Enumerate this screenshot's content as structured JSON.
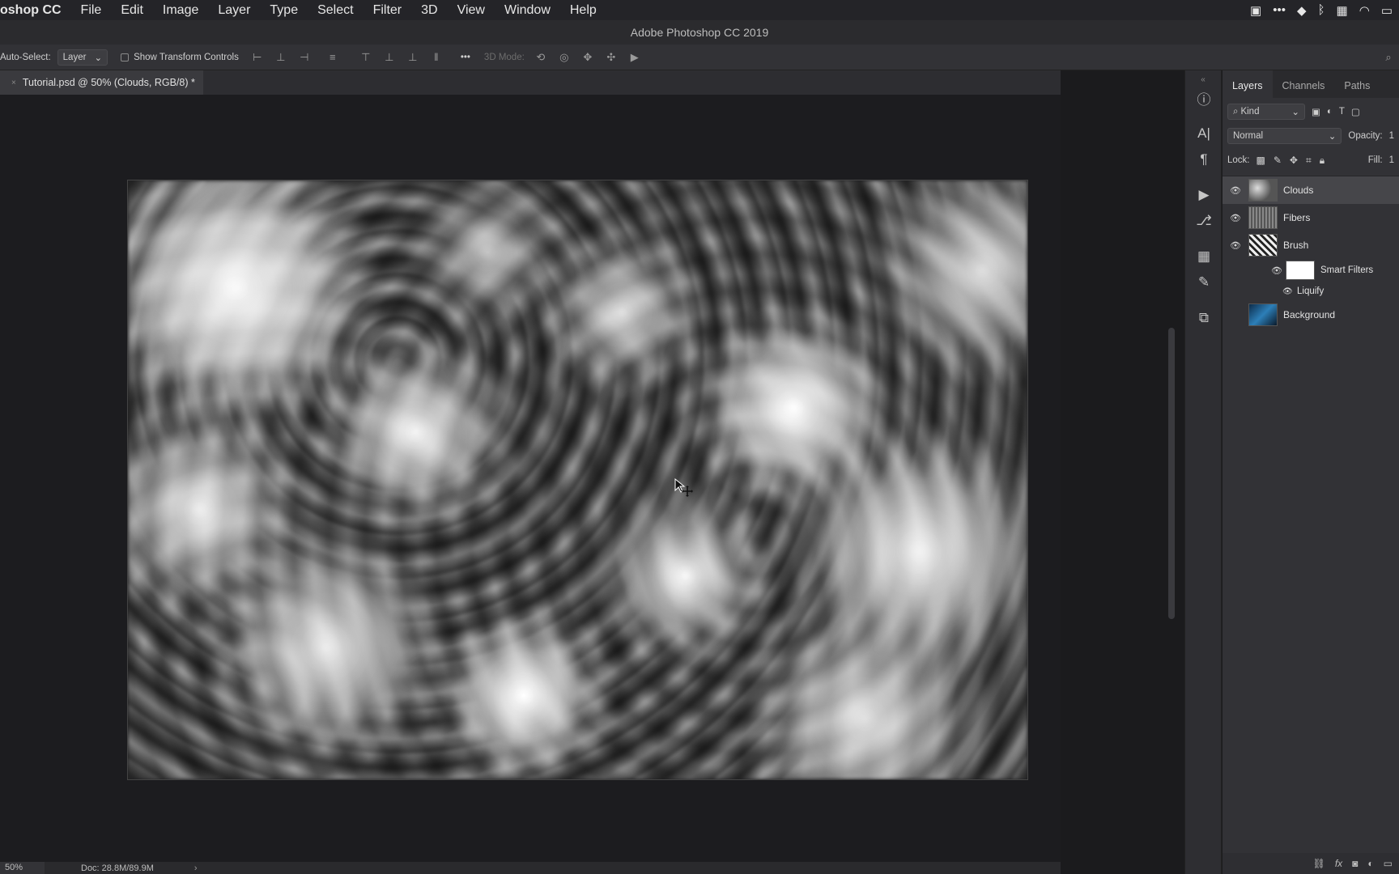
{
  "menubar": {
    "app_name": "oshop CC",
    "items": [
      "File",
      "Edit",
      "Image",
      "Layer",
      "Type",
      "Select",
      "Filter",
      "3D",
      "View",
      "Window",
      "Help"
    ]
  },
  "window_title": "Adobe Photoshop CC 2019",
  "options_bar": {
    "auto_select_label": "Auto-Select:",
    "auto_select_value": "Layer",
    "show_transform_label": "Show Transform Controls",
    "more_label": "•••",
    "mode_3d_label": "3D Mode:"
  },
  "document_tab": {
    "title": "Tutorial.psd @ 50% (Clouds, RGB/8) *"
  },
  "status_bar": {
    "zoom": "50%",
    "doc_size": "Doc: 28.8M/89.9M",
    "arrow": "›"
  },
  "panel": {
    "tabs": [
      "Layers",
      "Channels",
      "Paths"
    ],
    "kind_label": "Kind",
    "blend_mode": "Normal",
    "opacity_label": "Opacity:",
    "opacity_value": "1",
    "lock_label": "Lock:",
    "fill_label": "Fill:",
    "fill_value": "1"
  },
  "layers": [
    {
      "name": "Clouds",
      "selected": true
    },
    {
      "name": "Fibers",
      "selected": false
    },
    {
      "name": "Brush",
      "selected": false
    },
    {
      "name": "Background",
      "selected": false
    }
  ],
  "smart_filters": {
    "label": "Smart Filters",
    "filter": "Liquify"
  },
  "icons": {
    "eye": "eye-icon",
    "search": "search-icon",
    "info": "info-icon",
    "wifi": "wifi-icon",
    "bluetooth": "bluetooth-icon",
    "battery": "battery-icon"
  },
  "colors": {
    "accent_bg": "#323236",
    "selected_layer": "#46464a"
  }
}
